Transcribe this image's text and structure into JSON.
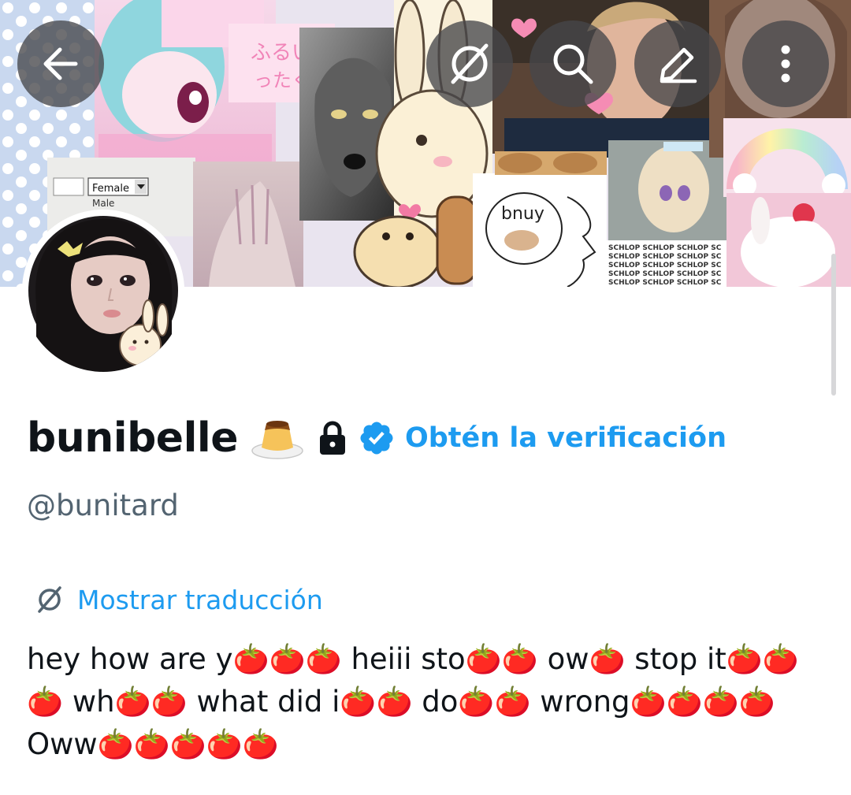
{
  "header": {
    "buttons": [
      {
        "name": "back",
        "icon": "arrow-left-icon"
      },
      {
        "name": "translate",
        "icon": "translate-icon"
      },
      {
        "name": "search",
        "icon": "search-icon"
      },
      {
        "name": "edit",
        "icon": "pencil-icon"
      },
      {
        "name": "more",
        "icon": "more-vertical-icon"
      }
    ],
    "banner_texts": {
      "dropdown_value": "Female",
      "dropdown_below": "Male",
      "speech_bubble": "bnuy",
      "japanese": "ふるい ったく",
      "schlop_line": "SCHLOP SCHLOP SCHLOP SC"
    }
  },
  "profile": {
    "display_name": "bunibelle",
    "name_emoji": "🍮",
    "protected_icon": "lock-icon",
    "verified_icon": "verified-badge-icon",
    "get_verified_label": "Obtén la verificación",
    "handle": "@bunitard",
    "show_translation_label": "Mostrar traducción",
    "bio": "hey how are y🍅🍅🍅 heiii sto🍅🍅 ow🍅 stop it🍅🍅 🍅 wh🍅🍅 what did i🍅🍅 do🍅🍅 wrong🍅🍅🍅🍅 Oww🍅🍅🍅🍅🍅"
  },
  "colors": {
    "accent": "#1d9bf0",
    "text": "#0f1419",
    "secondary_text": "#536471",
    "overlay_button": "#46464a"
  }
}
